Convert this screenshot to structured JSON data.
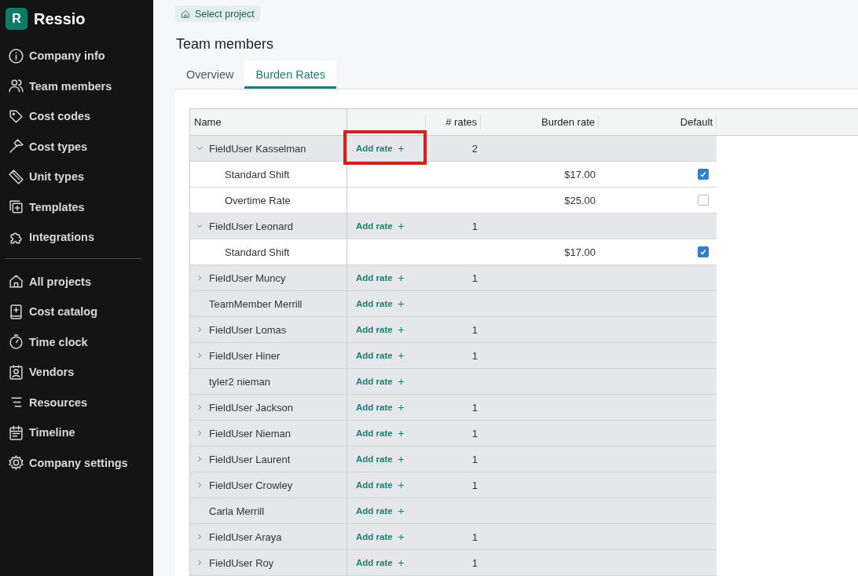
{
  "sidebar": {
    "brand": "Ressio",
    "logo_letter": "R",
    "sections": [
      {
        "items": [
          {
            "label": "Company info"
          },
          {
            "label": "Team members"
          },
          {
            "label": "Cost codes"
          },
          {
            "label": "Cost types"
          },
          {
            "label": "Unit types"
          },
          {
            "label": "Templates"
          },
          {
            "label": "Integrations"
          }
        ]
      },
      {
        "items": [
          {
            "label": "All projects"
          },
          {
            "label": "Cost catalog"
          },
          {
            "label": "Time clock"
          },
          {
            "label": "Vendors"
          },
          {
            "label": "Resources"
          },
          {
            "label": "Timeline"
          },
          {
            "label": "Company settings"
          }
        ]
      }
    ]
  },
  "breadcrumb": {
    "label": "Select project"
  },
  "page_title": "Team members",
  "tabs": [
    {
      "label": "Overview",
      "selected": false
    },
    {
      "label": "Burden Rates",
      "selected": true
    }
  ],
  "table": {
    "columns": [
      "Name",
      "",
      "# rates",
      "Burden rate",
      "Default"
    ],
    "rows": [
      {
        "kind": "member",
        "name": "FieldUser Kasselman",
        "expanded": true,
        "add_label": "Add rate",
        "rates": "2",
        "highlighted": true
      },
      {
        "kind": "rate",
        "name": "Standard Shift",
        "rate": "$17.00",
        "default": true
      },
      {
        "kind": "rate",
        "name": "Overtime Rate",
        "rate": "$25.00",
        "default": false
      },
      {
        "kind": "member",
        "name": "FieldUser Leonard",
        "expanded": true,
        "add_label": "Add rate",
        "rates": "1"
      },
      {
        "kind": "rate",
        "name": "Standard Shift",
        "rate": "$17.00",
        "default": true
      },
      {
        "kind": "member",
        "name": "FieldUser Muncy",
        "expanded": false,
        "add_label": "Add rate",
        "rates": "1"
      },
      {
        "kind": "member",
        "name": "TeamMember Merrill",
        "add_label": "Add rate"
      },
      {
        "kind": "member",
        "name": "FieldUser Lomas",
        "expanded": false,
        "add_label": "Add rate",
        "rates": "1"
      },
      {
        "kind": "member",
        "name": "FieldUser Hiner",
        "expanded": false,
        "add_label": "Add rate",
        "rates": "1"
      },
      {
        "kind": "member",
        "name": "tyler2 nieman",
        "add_label": "Add rate"
      },
      {
        "kind": "member",
        "name": "FieldUser Jackson",
        "expanded": false,
        "add_label": "Add rate",
        "rates": "1"
      },
      {
        "kind": "member",
        "name": "FieldUser Nieman",
        "expanded": false,
        "add_label": "Add rate",
        "rates": "1"
      },
      {
        "kind": "member",
        "name": "FieldUser Laurent",
        "expanded": false,
        "add_label": "Add rate",
        "rates": "1"
      },
      {
        "kind": "member",
        "name": "FieldUser Crowley",
        "expanded": false,
        "add_label": "Add rate",
        "rates": "1"
      },
      {
        "kind": "member",
        "name": "Carla Merrill",
        "add_label": "Add rate"
      },
      {
        "kind": "member",
        "name": "FieldUser Araya",
        "expanded": false,
        "add_label": "Add rate",
        "rates": "1"
      },
      {
        "kind": "member",
        "name": "FieldUser Roy",
        "expanded": false,
        "add_label": "Add rate",
        "rates": "1"
      }
    ]
  }
}
